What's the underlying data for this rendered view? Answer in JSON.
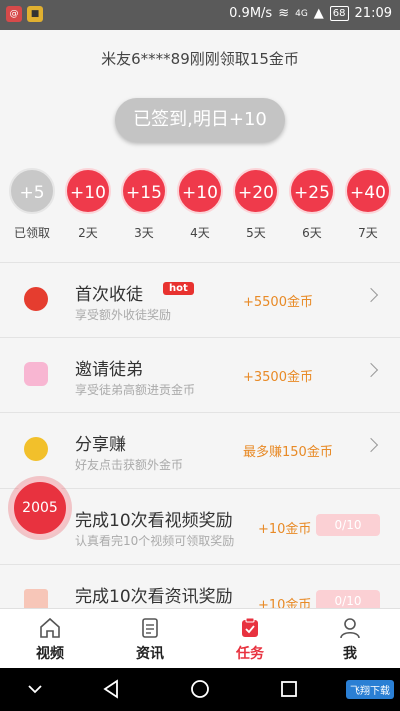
{
  "status_bar": {
    "speed": "0.9M/s",
    "network": "4G",
    "battery": "68",
    "time": "21:09"
  },
  "notice": "米友6****89刚刚领取15金币",
  "signin_button": "已签到,明日+10",
  "days": [
    {
      "value": "+5",
      "label": "已领取",
      "claimed": true
    },
    {
      "value": "+10",
      "label": "2天",
      "claimed": false
    },
    {
      "value": "+15",
      "label": "3天",
      "claimed": false
    },
    {
      "value": "+10",
      "label": "4天",
      "claimed": false
    },
    {
      "value": "+20",
      "label": "5天",
      "claimed": false
    },
    {
      "value": "+25",
      "label": "6天",
      "claimed": false
    },
    {
      "value": "+40",
      "label": "7天",
      "claimed": false
    }
  ],
  "tasks": [
    {
      "title": "首次收徒",
      "subtitle": "享受额外收徒奖励",
      "reward": "+5500金币",
      "hot": "hot"
    },
    {
      "title": "邀请徒弟",
      "subtitle": "享受徒弟高额进贡金币",
      "reward": "+3500金币"
    },
    {
      "title": "分享赚",
      "subtitle": "好友点击获额外金币",
      "reward": "最多赚150金币"
    },
    {
      "title": "完成10次看视频奖励",
      "subtitle": "认真看完10个视频可领取奖励",
      "reward": "+10金币",
      "progress": "0/10"
    },
    {
      "title": "完成10次看资讯奖励",
      "subtitle": "",
      "reward": "+10金币",
      "progress": "0/10"
    }
  ],
  "floating_badge": "2005",
  "tabs": [
    {
      "label": "视频",
      "icon": "home-icon"
    },
    {
      "label": "资讯",
      "icon": "document-icon"
    },
    {
      "label": "任务",
      "icon": "task-icon",
      "active": true
    },
    {
      "label": "我",
      "icon": "user-icon"
    }
  ],
  "watermark": "飞翔下载",
  "colors": {
    "accent": "#e8323f",
    "reward": "#e88a26",
    "claimed": "#c8c8c8"
  }
}
